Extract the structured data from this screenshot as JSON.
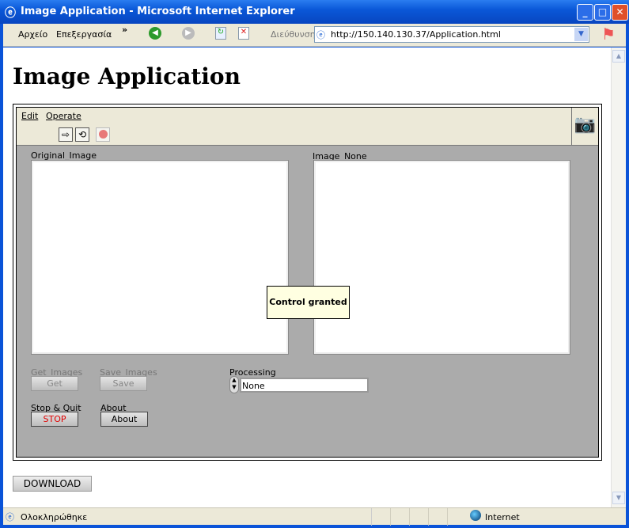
{
  "window": {
    "title": "Image Application - Microsoft Internet Explorer",
    "minimize": "_",
    "maximize": "□",
    "close": "✕"
  },
  "toolbar": {
    "menu_file": "Αρχείο",
    "menu_edit": "Επεξεργασία",
    "more": "»",
    "address_label": "Διεύθυνση",
    "address": "http://150.140.130.37/Application.html"
  },
  "page": {
    "heading": "Image Application",
    "download_label": "DOWNLOAD"
  },
  "vi": {
    "menu": [
      "Edit",
      "Operate"
    ],
    "original_label": "Original_Image",
    "processed_label": "Image_None",
    "get_label": "Get_Images",
    "get_button": "Get",
    "save_label": "Save_Images",
    "save_button": "Save",
    "stop_label": "Stop & Quit",
    "stop_button": "STOP",
    "about_label": "About",
    "about_button": "About",
    "processing_label": "Processing",
    "processing_value": "None",
    "tooltip": "Control granted"
  },
  "status": {
    "text": "Ολοκληρώθηκε",
    "zone": "Internet"
  },
  "colors": {
    "titlebar": "#0a58d8",
    "panel_bg": "#ababab",
    "stop_text": "#e00000",
    "tooltip_bg": "#ffffe1"
  }
}
